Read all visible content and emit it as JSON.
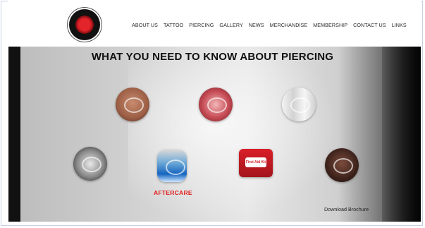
{
  "nav": {
    "items": [
      "ABOUT US",
      "TATTOO",
      "PIERCING",
      "GALLERY",
      "NEWS",
      "MERCHANDISE",
      "MEMBERSHIP",
      "CONTACT US",
      "LINKS"
    ]
  },
  "hero": {
    "title": "WHAT YOU NEED TO KNOW ABOUT PIERCING",
    "aftercare_label": "AFTERCARE",
    "brochure_label": "Download Brochure"
  },
  "colors": {
    "accent": "#e11d1d",
    "text": "#2b2b2b"
  },
  "icons": [
    "logo-icon",
    "ear-piercing-icon",
    "lip-piercing-icon",
    "jewelry-icon",
    "needle-icon",
    "aftercare-bottle-icon",
    "first-aid-kit-icon",
    "spiral-jewelry-icon"
  ]
}
